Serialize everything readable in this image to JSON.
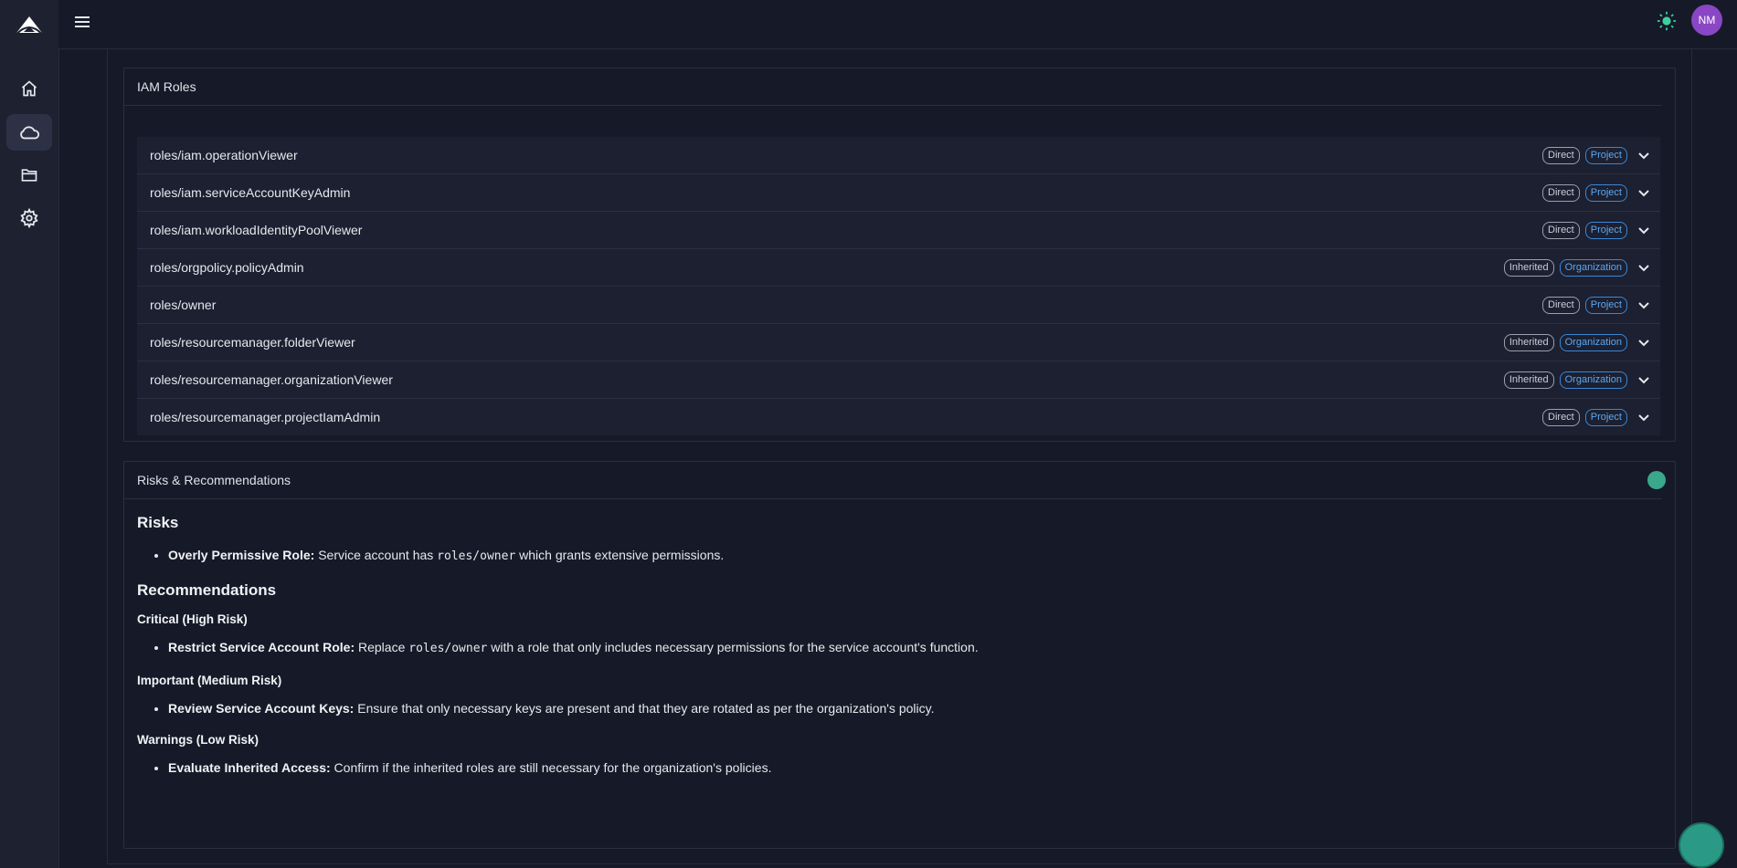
{
  "topbar": {
    "avatar_initials": "NM"
  },
  "sidebar": {
    "items": [
      {
        "icon": "home-icon"
      },
      {
        "icon": "cloud-icon",
        "active": true
      },
      {
        "icon": "folder-icon"
      },
      {
        "icon": "settings-icon"
      }
    ]
  },
  "iam": {
    "title": "IAM Roles",
    "roles": [
      {
        "name": "roles/iam.operationViewer",
        "type": "Direct",
        "scope": "Project"
      },
      {
        "name": "roles/iam.serviceAccountKeyAdmin",
        "type": "Direct",
        "scope": "Project"
      },
      {
        "name": "roles/iam.workloadIdentityPoolViewer",
        "type": "Direct",
        "scope": "Project"
      },
      {
        "name": "roles/orgpolicy.policyAdmin",
        "type": "Inherited",
        "scope": "Organization"
      },
      {
        "name": "roles/owner",
        "type": "Direct",
        "scope": "Project"
      },
      {
        "name": "roles/resourcemanager.folderViewer",
        "type": "Inherited",
        "scope": "Organization"
      },
      {
        "name": "roles/resourcemanager.organizationViewer",
        "type": "Inherited",
        "scope": "Organization"
      },
      {
        "name": "roles/resourcemanager.projectIamAdmin",
        "type": "Direct",
        "scope": "Project"
      }
    ]
  },
  "risks": {
    "title": "Risks & Recommendations",
    "risks_heading": "Risks",
    "risk1_bold": "Overly Permissive Role:",
    "risk1_pre": " Service account has ",
    "risk1_code": "roles/owner",
    "risk1_post": " which grants extensive permissions.",
    "rec_heading": "Recommendations",
    "critical_heading": "Critical (High Risk)",
    "crit1_bold": "Restrict Service Account Role:",
    "crit1_pre": " Replace ",
    "crit1_code": "roles/owner",
    "crit1_post": " with a role that only includes necessary permissions for the service account's function.",
    "important_heading": "Important (Medium Risk)",
    "imp1_bold": "Review Service Account Keys:",
    "imp1_text": " Ensure that only necessary keys are present and that they are rotated as per the organization's policy.",
    "warnings_heading": "Warnings (Low Risk)",
    "warn1_bold": "Evaluate Inherited Access:",
    "warn1_text": " Confirm if the inherited roles are still necessary for the organization's policies."
  },
  "colors": {
    "accent": "#3b86d6",
    "avatar": "#8a46c4",
    "sun": "#3ecf9f"
  }
}
